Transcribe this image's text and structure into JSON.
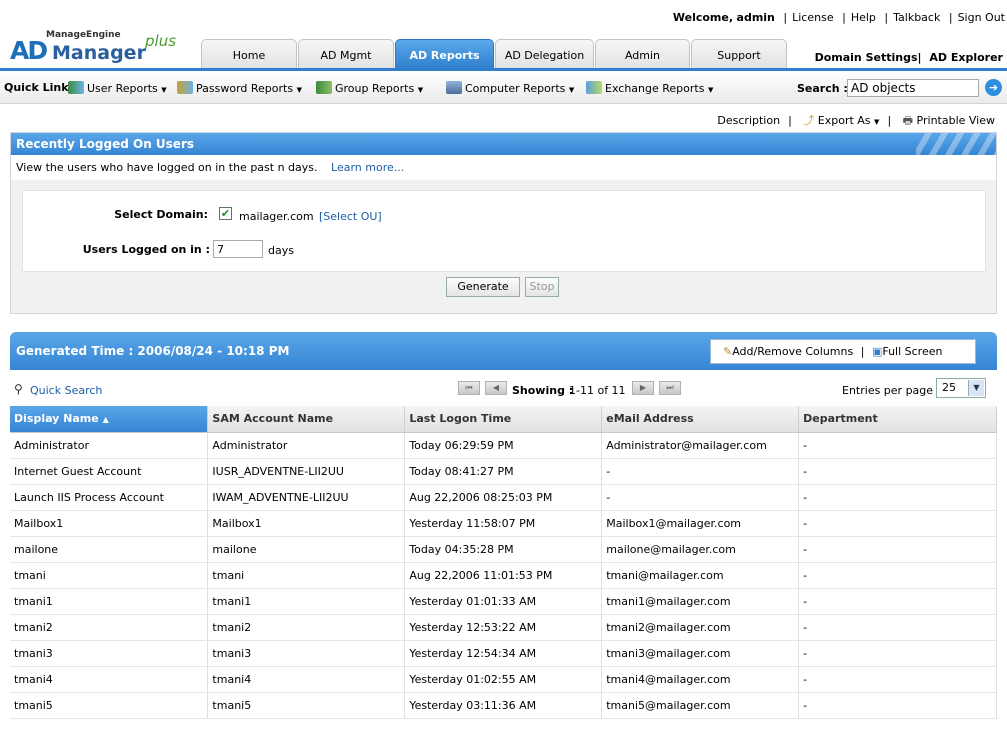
{
  "header": {
    "welcome": "Welcome,",
    "user": "admin",
    "links": [
      "License",
      "Help",
      "Talkback",
      "Sign Out"
    ],
    "brand_top": "ManageEngine",
    "brand_ad": "AD",
    "brand_manager": "Manager",
    "brand_plus": "plus",
    "domain_settings": "Domain Settings",
    "ad_explorer": "AD Explorer"
  },
  "tabs": [
    {
      "label": "Home",
      "active": false
    },
    {
      "label": "AD Mgmt",
      "active": false
    },
    {
      "label": "AD Reports",
      "active": true
    },
    {
      "label": "AD Delegation",
      "active": false
    },
    {
      "label": "Admin",
      "active": false
    },
    {
      "label": "Support",
      "active": false
    }
  ],
  "quicklinks": {
    "label": "Quick Link :",
    "items": [
      "User Reports",
      "Password Reports",
      "Group Reports",
      "Computer Reports",
      "Exchange Reports"
    ]
  },
  "search": {
    "label": "Search :",
    "value": "AD objects"
  },
  "actions": {
    "description": "Description",
    "export": "Export As",
    "printable": "Printable View"
  },
  "panel": {
    "title": "Recently Logged On Users",
    "description": "View the users who have logged on in the past n days.",
    "learn_more": "Learn more...",
    "domain_label": "Select Domain:",
    "domain_value": "mailager.com",
    "select_ou": "[Select OU]",
    "days_label": "Users Logged on in :",
    "days_value": "7",
    "days_unit": "days",
    "generate": "Generate",
    "stop": "Stop"
  },
  "results": {
    "generated": "Generated Time : 2006/08/24 - 10:18 PM",
    "add_remove_columns": "Add/Remove Columns",
    "full_screen": "Full Screen",
    "quick_search": "Quick Search",
    "showing_label": "Showing :",
    "showing_range": "1-11 of 11",
    "entries_label": "Entries per page",
    "entries_value": "25"
  },
  "table": {
    "columns": [
      "Display Name",
      "SAM Account Name",
      "Last Logon Time",
      "eMail Address",
      "Department"
    ],
    "rows": [
      [
        "Administrator",
        "Administrator",
        "Today 06:29:59 PM",
        "Administrator@mailager.com",
        "-"
      ],
      [
        "Internet Guest Account",
        "IUSR_ADVENTNE-LII2UU",
        "Today 08:41:27 PM",
        "-",
        "-"
      ],
      [
        "Launch IIS Process Account",
        "IWAM_ADVENTNE-LII2UU",
        "Aug 22,2006 08:25:03 PM",
        "-",
        "-"
      ],
      [
        "Mailbox1",
        "Mailbox1",
        "Yesterday 11:58:07 PM",
        "Mailbox1@mailager.com",
        "-"
      ],
      [
        "mailone",
        "mailone",
        "Today 04:35:28 PM",
        "mailone@mailager.com",
        "-"
      ],
      [
        "tmani",
        "tmani",
        "Aug 22,2006 11:01:53 PM",
        "tmani@mailager.com",
        "-"
      ],
      [
        "tmani1",
        "tmani1",
        "Yesterday 01:01:33 AM",
        "tmani1@mailager.com",
        "-"
      ],
      [
        "tmani2",
        "tmani2",
        "Yesterday 12:53:22 AM",
        "tmani2@mailager.com",
        "-"
      ],
      [
        "tmani3",
        "tmani3",
        "Yesterday 12:54:34 AM",
        "tmani3@mailager.com",
        "-"
      ],
      [
        "tmani4",
        "tmani4",
        "Yesterday 01:02:55 AM",
        "tmani4@mailager.com",
        "-"
      ],
      [
        "tmani5",
        "tmani5",
        "Yesterday 03:11:36 AM",
        "tmani5@mailager.com",
        "-"
      ]
    ]
  },
  "colors": {
    "accent": "#3585d3",
    "link": "#1c5fa8"
  }
}
